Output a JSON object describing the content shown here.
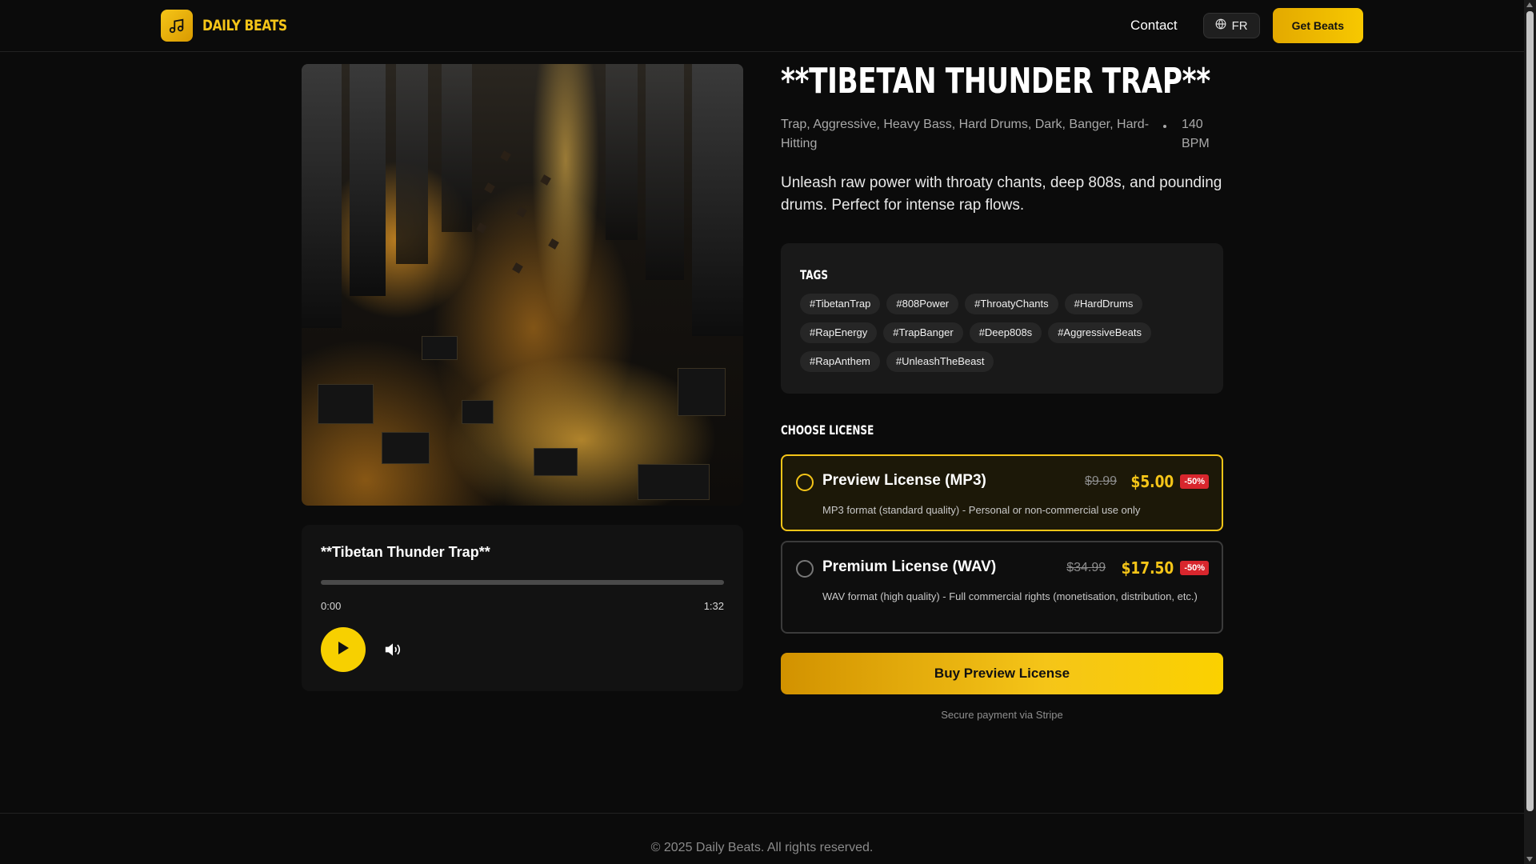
{
  "header": {
    "brand": "DAILY BEATS",
    "nav_contact": "Contact",
    "lang": "FR",
    "cta": "Get Beats"
  },
  "player": {
    "title": "**Tibetan Thunder Trap**",
    "current_time": "0:00",
    "total_time": "1:32",
    "progress": 0
  },
  "beat": {
    "title": "**TIBETAN THUNDER TRAP**",
    "genres": "Trap, Aggressive, Heavy Bass, Hard Drums, Dark, Banger, Hard-Hitting",
    "bpm": "140 BPM",
    "description": "Unleash raw power with throaty chants, deep 808s, and pounding drums. Perfect for intense rap flows."
  },
  "tags": {
    "heading": "TAGS",
    "items": [
      "#TibetanTrap",
      "#808Power",
      "#ThroatyChants",
      "#HardDrums",
      "#RapEnergy",
      "#TrapBanger",
      "#Deep808s",
      "#AggressiveBeats",
      "#RapAnthem",
      "#UnleashTheBeast"
    ]
  },
  "licenses": {
    "heading": "CHOOSE LICENSE",
    "items": [
      {
        "name": "Preview License (MP3)",
        "old_price": "$9.99",
        "price": "$5.00",
        "discount": "-50%",
        "description": "MP3 format (standard quality) - Personal or non-commercial use only",
        "selected": true
      },
      {
        "name": "Premium License (WAV)",
        "old_price": "$34.99",
        "price": "$17.50",
        "discount": "-50%",
        "description": "WAV format (high quality) - Full commercial rights (monetisation, distribution, etc.)",
        "selected": false
      }
    ]
  },
  "buy_button": "Buy Preview License",
  "secure_note": "Secure payment via Stripe",
  "footer": "© 2025 Daily Beats. All rights reserved.",
  "colors": {
    "accent": "#f5c518",
    "background": "#0b0b0b",
    "discount": "#d8262d"
  },
  "icons": {
    "logo": "music-note-icon",
    "lang": "globe-icon",
    "play": "play-icon",
    "volume": "volume-icon"
  }
}
